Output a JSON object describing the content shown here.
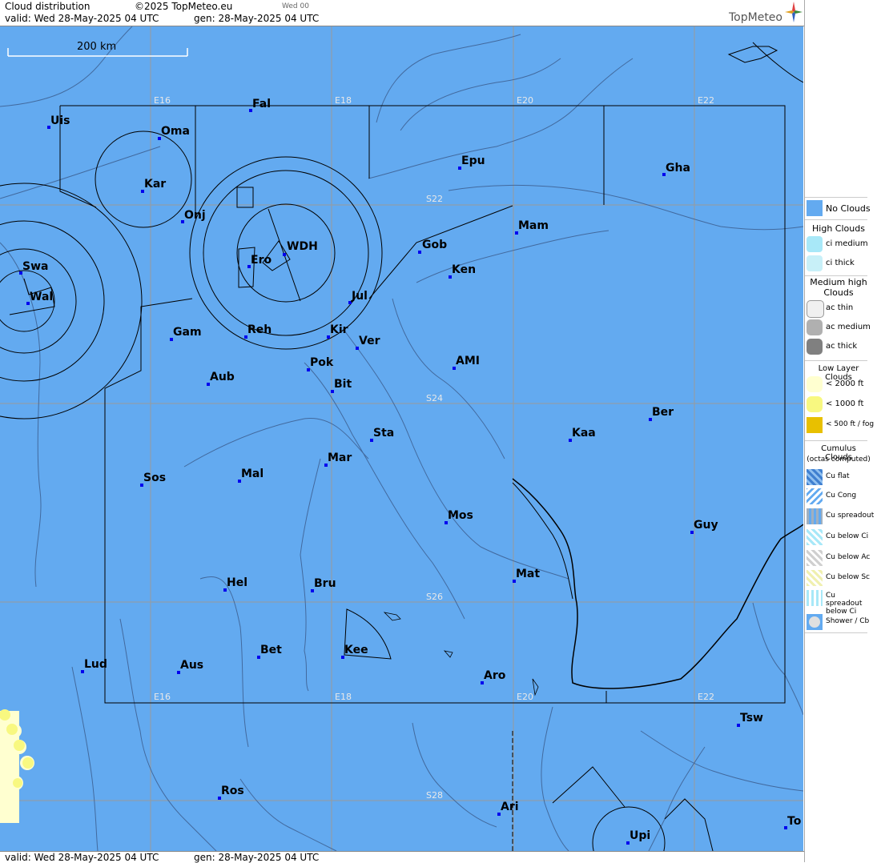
{
  "header": {
    "title": "Cloud distribution",
    "copyright": "©2025 TopMeteo.eu",
    "day_badge": "Wed 00",
    "valid": "valid:  Wed  28-May-2025  04 UTC",
    "gen": "gen: 28-May-2025 04 UTC",
    "logo": "TopMeteo"
  },
  "footer": {
    "valid": "valid:  Wed  28-May-2025  04 UTC",
    "gen": "gen: 28-May-2025 04 UTC"
  },
  "scale": {
    "label": "200 km"
  },
  "grid_labels": {
    "e16_top": "E16",
    "e18_top": "E18",
    "e20_top": "E20",
    "e22_top": "E22",
    "e16_bot": "E16",
    "e18_bot": "E18",
    "e20_bot": "E20",
    "e22_bot": "E22",
    "s22": "S22",
    "s24": "S24",
    "s26": "S26",
    "s28": "S28"
  },
  "cities": [
    {
      "name": "Fal"
    },
    {
      "name": "Uis"
    },
    {
      "name": "Oma"
    },
    {
      "name": "Epu"
    },
    {
      "name": "Gha"
    },
    {
      "name": "Kar"
    },
    {
      "name": "Onj"
    },
    {
      "name": "Mam"
    },
    {
      "name": "Swa"
    },
    {
      "name": "Gob"
    },
    {
      "name": "WDH"
    },
    {
      "name": "Ero"
    },
    {
      "name": "Ken"
    },
    {
      "name": "Wal"
    },
    {
      "name": "Jul"
    },
    {
      "name": "Gam"
    },
    {
      "name": "Reh"
    },
    {
      "name": "Kir"
    },
    {
      "name": "Ver"
    },
    {
      "name": "Pok"
    },
    {
      "name": "AMI"
    },
    {
      "name": "Aub"
    },
    {
      "name": "Bit"
    },
    {
      "name": "Ber"
    },
    {
      "name": "Sta"
    },
    {
      "name": "Kaa"
    },
    {
      "name": "Mar"
    },
    {
      "name": "Sos"
    },
    {
      "name": "Mal"
    },
    {
      "name": "Mos"
    },
    {
      "name": "Guy"
    },
    {
      "name": "Mat"
    },
    {
      "name": "Hel"
    },
    {
      "name": "Bru"
    },
    {
      "name": "Bet"
    },
    {
      "name": "Kee"
    },
    {
      "name": "Lud"
    },
    {
      "name": "Aus"
    },
    {
      "name": "Aro"
    },
    {
      "name": "Tsw"
    },
    {
      "name": "Ros"
    },
    {
      "name": "Ari"
    },
    {
      "name": "To"
    },
    {
      "name": "Upi"
    }
  ],
  "legend": {
    "no_clouds": "No Clouds",
    "high_head": "High Clouds",
    "ci_medium": "ci medium",
    "ci_thick": "ci thick",
    "medium_head": "Medium high Clouds",
    "ac_thin": "ac thin",
    "ac_medium": "ac medium",
    "ac_thick": "ac thick",
    "low_head": "Low Layer Clouds",
    "low_2000": "< 2000 ft",
    "low_1000": "< 1000 ft",
    "low_500": "< 500 ft / fog",
    "cu_head": "Cumulus Clouds",
    "cu_sub": "(octas computed)",
    "cu_flat": "Cu flat",
    "cu_cong": "Cu Cong",
    "cu_spreadout": "Cu spreadout",
    "cu_below_ci": "Cu below Ci",
    "cu_below_ac": "Cu below Ac",
    "cu_below_sc": "Cu below Sc",
    "cu_spread_ci": "Cu spreadout below Ci",
    "shower": "Shower / Cb"
  },
  "colors": {
    "no_clouds": "#63aaf0",
    "ci_medium": "#a8e8f8",
    "ci_thick": "#c8f0f8",
    "ac_thin": "#f0f0f0",
    "ac_medium": "#b0b0b0",
    "ac_thick": "#808080",
    "low_2000": "#ffffd0",
    "low_1000": "#f8f880",
    "low_500": "#e8c000"
  }
}
